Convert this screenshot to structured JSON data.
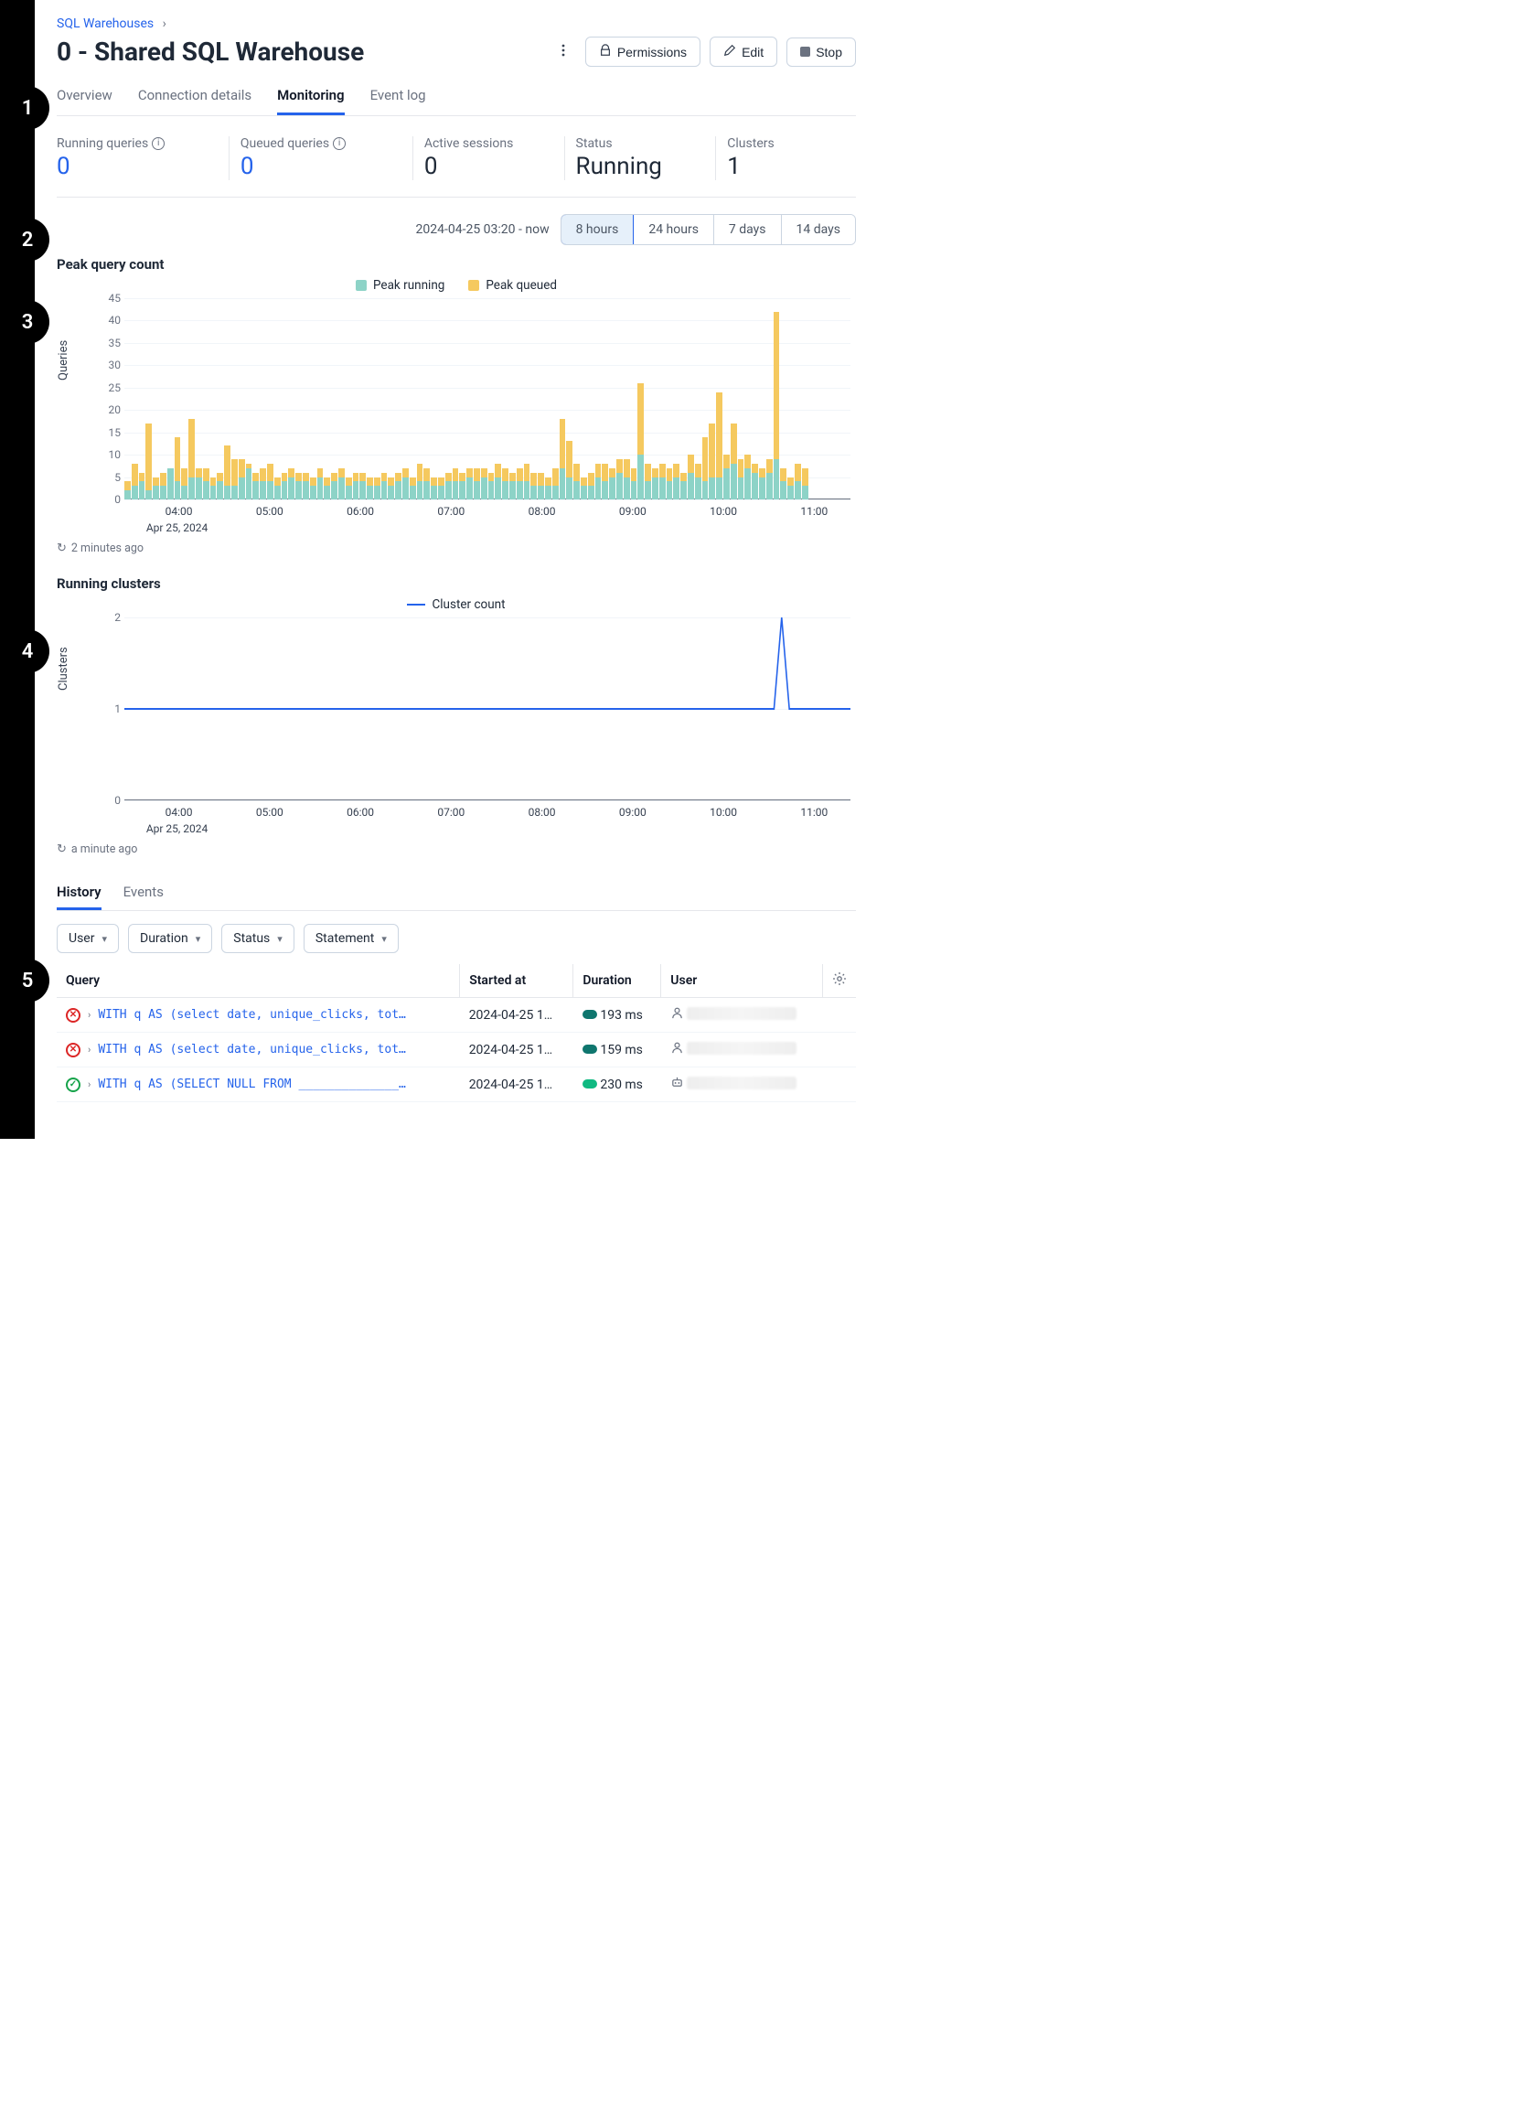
{
  "breadcrumb": {
    "root": "SQL Warehouses"
  },
  "title": "0 - Shared SQL Warehouse",
  "actions": {
    "permissions": "Permissions",
    "edit": "Edit",
    "stop": "Stop"
  },
  "tabs": [
    "Overview",
    "Connection details",
    "Monitoring",
    "Event log"
  ],
  "active_tab": "Monitoring",
  "metrics": {
    "running": {
      "label": "Running queries",
      "value": "0"
    },
    "queued": {
      "label": "Queued queries",
      "value": "0"
    },
    "sessions": {
      "label": "Active sessions",
      "value": "0"
    },
    "status": {
      "label": "Status",
      "value": "Running"
    },
    "clusters": {
      "label": "Clusters",
      "value": "1"
    }
  },
  "time_range": {
    "text": "2024-04-25 03:20 - now",
    "options": [
      "8 hours",
      "24 hours",
      "7 days",
      "14 days"
    ],
    "active": "8 hours"
  },
  "peak_chart": {
    "title": "Peak query count",
    "ylabel": "Queries",
    "legend": {
      "running": "Peak running",
      "queued": "Peak queued"
    },
    "colors": {
      "running": "#8dd3c7",
      "queued": "#f5c95f"
    },
    "refresh": "2 minutes ago",
    "x_ticks": [
      "04:00",
      "05:00",
      "06:00",
      "07:00",
      "08:00",
      "09:00",
      "10:00",
      "11:00"
    ],
    "x_date": "Apr 25, 2024",
    "y_ticks": [
      0,
      5,
      10,
      15,
      20,
      25,
      30,
      35,
      40,
      45
    ]
  },
  "chart_data": [
    {
      "type": "bar",
      "title": "Peak query count",
      "xlabel": "",
      "ylabel": "Queries",
      "ylim": [
        0,
        45
      ],
      "x_time_range": "2024-04-25 03:20 – 11:20",
      "legend": [
        "Peak running",
        "Peak queued"
      ],
      "categories_note": "5-minute bins from ~03:20 to ~11:20 (≈96 bins)",
      "series": [
        {
          "name": "Peak running",
          "color": "#8dd3c7",
          "values": [
            2,
            3,
            4,
            2,
            3,
            3,
            7,
            4,
            3,
            5,
            5,
            4,
            3,
            4,
            3,
            3,
            5,
            7,
            4,
            4,
            4,
            3,
            4,
            5,
            4,
            4,
            3,
            5,
            3,
            4,
            5,
            3,
            4,
            4,
            3,
            3,
            4,
            3,
            4,
            5,
            3,
            4,
            4,
            3,
            3,
            4,
            4,
            4,
            5,
            4,
            5,
            4,
            5,
            4,
            4,
            4,
            4,
            3,
            3,
            3,
            3,
            7,
            5,
            4,
            3,
            3,
            5,
            4,
            5,
            6,
            5,
            4,
            10,
            4,
            5,
            5,
            4,
            5,
            4,
            6,
            5,
            4,
            5,
            5,
            7,
            8,
            5,
            7,
            6,
            5,
            6,
            9,
            4,
            3,
            4,
            3
          ]
        },
        {
          "name": "Peak queued",
          "color": "#f5c95f",
          "values": [
            2,
            5,
            2,
            15,
            2,
            3,
            0,
            10,
            4,
            13,
            2,
            3,
            2,
            2,
            9,
            6,
            4,
            1,
            2,
            3,
            4,
            2,
            2,
            2,
            2,
            2,
            2,
            2,
            2,
            2,
            2,
            2,
            2,
            2,
            2,
            2,
            2,
            2,
            2,
            2,
            2,
            4,
            3,
            2,
            2,
            2,
            3,
            2,
            2,
            3,
            2,
            2,
            3,
            3,
            2,
            3,
            4,
            3,
            3,
            2,
            4,
            11,
            8,
            4,
            2,
            3,
            3,
            4,
            2,
            3,
            4,
            3,
            16,
            4,
            2,
            3,
            3,
            3,
            2,
            4,
            3,
            10,
            12,
            19,
            3,
            9,
            4,
            3,
            2,
            2,
            3,
            33,
            3,
            2,
            4,
            4
          ]
        }
      ]
    },
    {
      "type": "line",
      "title": "Running clusters",
      "xlabel": "",
      "ylabel": "Clusters",
      "ylim": [
        0,
        2
      ],
      "x_time_range": "2024-04-25 03:20 – 11:20",
      "legend": [
        "Cluster count"
      ],
      "data_note": "Constant at 1 the entire window except a brief spike to 2 near 10:30",
      "series": [
        {
          "name": "Cluster count",
          "color": "#2563eb",
          "values": [
            1,
            1,
            1,
            1,
            1,
            1,
            1,
            1,
            1,
            1,
            1,
            1,
            1,
            1,
            1,
            1,
            1,
            1,
            1,
            1,
            1,
            1,
            1,
            1,
            1,
            1,
            1,
            1,
            1,
            1,
            1,
            1,
            1,
            1,
            1,
            1,
            1,
            1,
            1,
            1,
            1,
            1,
            1,
            1,
            1,
            1,
            1,
            1,
            1,
            1,
            1,
            1,
            1,
            1,
            1,
            1,
            1,
            1,
            1,
            1,
            1,
            1,
            1,
            1,
            1,
            1,
            1,
            1,
            1,
            1,
            1,
            1,
            1,
            1,
            1,
            1,
            1,
            1,
            1,
            1,
            1,
            1,
            1,
            1,
            1,
            1,
            2,
            1,
            1,
            1,
            1,
            1,
            1,
            1,
            1,
            1
          ]
        }
      ]
    }
  ],
  "cluster_chart": {
    "title": "Running clusters",
    "ylabel": "Clusters",
    "legend": "Cluster count",
    "color": "#2563eb",
    "refresh": "a minute ago",
    "x_ticks": [
      "04:00",
      "05:00",
      "06:00",
      "07:00",
      "08:00",
      "09:00",
      "10:00",
      "11:00"
    ],
    "x_date": "Apr 25, 2024",
    "y_ticks": [
      0,
      1,
      2
    ]
  },
  "subtabs": [
    "History",
    "Events"
  ],
  "active_subtab": "History",
  "filters": [
    "User",
    "Duration",
    "Status",
    "Statement"
  ],
  "table": {
    "columns": [
      "Query",
      "Started at",
      "Duration",
      "User"
    ],
    "rows": [
      {
        "status": "fail",
        "query": "WITH q AS (select date, unique_clicks, total_…",
        "started": "2024-04-25 1…",
        "duration": "193 ms",
        "user_type": "person",
        "dur_pill": "blue"
      },
      {
        "status": "fail",
        "query": "WITH q AS (select date, unique_clicks, total_…",
        "started": "2024-04-25 1…",
        "duration": "159 ms",
        "user_type": "person",
        "dur_pill": "blue"
      },
      {
        "status": "ok",
        "query": "WITH q AS (SELECT NULL FROM ______________.____…",
        "started": "2024-04-25 1…",
        "duration": "230 ms",
        "user_type": "bot",
        "dur_pill": "teal"
      }
    ]
  },
  "markers": [
    {
      "n": "1",
      "top": 94
    },
    {
      "n": "2",
      "top": 238
    },
    {
      "n": "3",
      "top": 328
    },
    {
      "n": "4",
      "top": 688
    },
    {
      "n": "5",
      "top": 1048
    }
  ]
}
